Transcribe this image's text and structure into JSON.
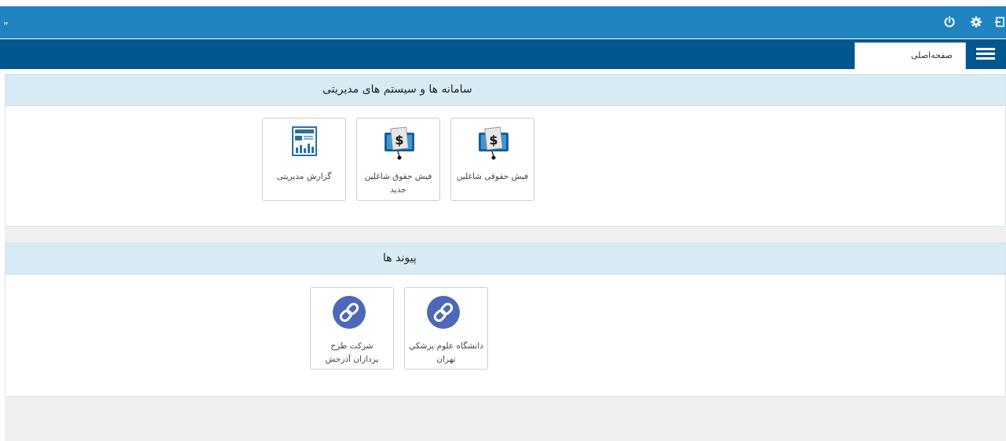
{
  "topbar": {
    "left_glyph": "„",
    "icons": [
      "power-icon",
      "gear-icon",
      "logout-icon"
    ]
  },
  "navbar": {
    "home_tab_label": "صفحه‌اصلی",
    "menu_icon": "hamburger-icon"
  },
  "systems_section": {
    "title": "سامانه ها و سیستم های مدیریتی",
    "tiles": [
      {
        "label": "فیش حقوقی شاغلین",
        "icon": "payslip-icon"
      },
      {
        "label": "فیش حقوق شاغلین جدید",
        "icon": "payslip-icon"
      },
      {
        "label": "گزارش مدیریتی",
        "icon": "report-icon"
      }
    ]
  },
  "links_section": {
    "title": "پیوند ها",
    "tiles": [
      {
        "label": "دانشگاه علوم پزشكي تهران",
        "icon": "link-icon"
      },
      {
        "label": "شرکت طرح پردازان آذرخش",
        "icon": "link-icon"
      }
    ]
  },
  "colors": {
    "topbar": "#1f84c0",
    "navbar": "#00568f",
    "panel_header": "#d7ebf5",
    "link_circle": "#4d68b8"
  }
}
